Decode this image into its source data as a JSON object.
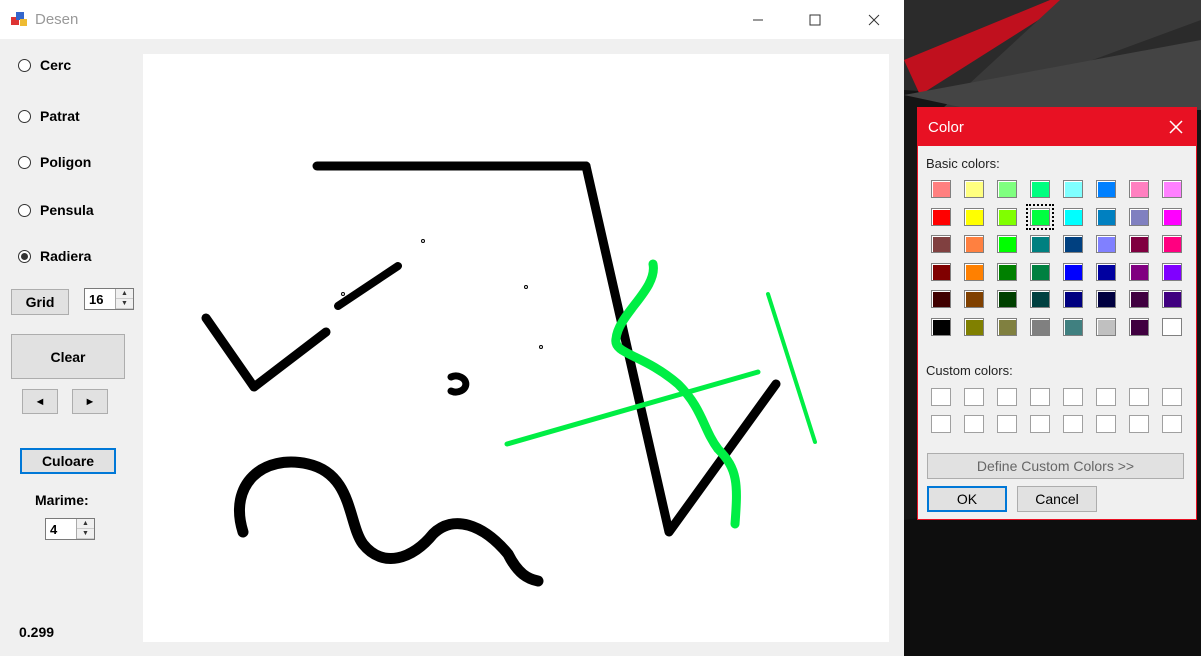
{
  "window": {
    "title": "Desen"
  },
  "radios": [
    {
      "label": "Cerc",
      "checked": false
    },
    {
      "label": "Patrat",
      "checked": false
    },
    {
      "label": "Poligon",
      "checked": false
    },
    {
      "label": "Pensula",
      "checked": false
    },
    {
      "label": "Radiera",
      "checked": true
    }
  ],
  "grid": {
    "button_label": "Grid",
    "value": "16"
  },
  "clear_label": "Clear",
  "nav": {
    "prev": "◄",
    "next": "►"
  },
  "color_button_label": "Culoare",
  "size": {
    "label": "Marime:",
    "value": "4"
  },
  "status_value": "0.299",
  "dialog": {
    "title": "Color",
    "basic_label": "Basic colors:",
    "custom_label": "Custom colors:",
    "define_label": "Define Custom Colors >>",
    "ok_label": "OK",
    "cancel_label": "Cancel",
    "selected_index": 11,
    "basic_colors": [
      "#ff8080",
      "#ffff80",
      "#80ff80",
      "#00ff80",
      "#80ffff",
      "#0080ff",
      "#ff80c0",
      "#ff80ff",
      "#ff0000",
      "#ffff00",
      "#80ff00",
      "#00ff40",
      "#00ffff",
      "#0080c0",
      "#8080c0",
      "#ff00ff",
      "#804040",
      "#ff8040",
      "#00ff00",
      "#008080",
      "#004080",
      "#8080ff",
      "#800040",
      "#ff0080",
      "#800000",
      "#ff8000",
      "#008000",
      "#008040",
      "#0000ff",
      "#0000a0",
      "#800080",
      "#8000ff",
      "#400000",
      "#804000",
      "#004000",
      "#004040",
      "#000080",
      "#000040",
      "#400040",
      "#400080",
      "#000000",
      "#808000",
      "#808040",
      "#808080",
      "#408080",
      "#c0c0c0",
      "#400040",
      "#ffffff"
    ]
  },
  "colors": {
    "accent": "#e81123",
    "brush_black": "#000000",
    "brush_green": "#00ee44"
  }
}
